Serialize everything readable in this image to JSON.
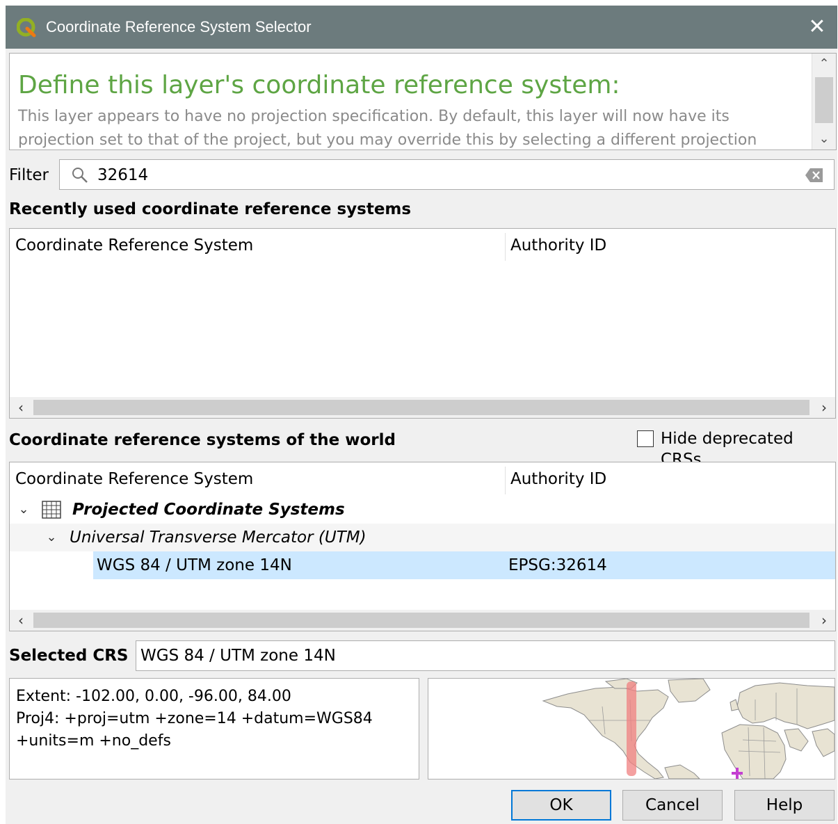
{
  "window": {
    "title": "Coordinate Reference System Selector",
    "close_glyph": "✕"
  },
  "message": {
    "heading": "Define this layer's coordinate reference system:",
    "body": "This layer appears to have no projection specification. By default, this layer will now have its projection set to that of the project, but you may override this by selecting a different projection below."
  },
  "filter": {
    "label": "Filter",
    "value": "32614"
  },
  "recent": {
    "title": "Recently used coordinate reference systems",
    "columns": [
      "Coordinate Reference System",
      "Authority ID"
    ]
  },
  "world": {
    "title": "Coordinate reference systems of the world",
    "hide_deprecated_label": "Hide deprecated CRSs",
    "hide_deprecated_checked": false,
    "columns": [
      "Coordinate Reference System",
      "Authority ID"
    ],
    "tree": {
      "group": "Projected Coordinate Systems",
      "subgroup": "Universal Transverse Mercator (UTM)",
      "selected_row": {
        "name": "WGS 84 / UTM zone 14N",
        "authority": "EPSG:32614"
      }
    }
  },
  "selected_crs": {
    "label": "Selected CRS",
    "value": "WGS 84 / UTM zone 14N"
  },
  "details": {
    "extent": "Extent: -102.00, 0.00, -96.00, 84.00",
    "proj4_line1": "Proj4: +proj=utm +zone=14 +datum=WGS84",
    "proj4_line2": "+units=m +no_defs"
  },
  "buttons": {
    "ok": "OK",
    "cancel": "Cancel",
    "help": "Help"
  },
  "colors": {
    "titlebar": "#6c7b7d",
    "heading_green": "#5ea544",
    "selection": "#cce8ff",
    "extent_band": "#f08080",
    "land": "#e8e3d3"
  },
  "icons": {
    "app": "qgis-logo-icon",
    "search": "search-icon",
    "clear": "clear-input-icon",
    "group": "grid-icon",
    "expand": "chevron-down-icon"
  }
}
